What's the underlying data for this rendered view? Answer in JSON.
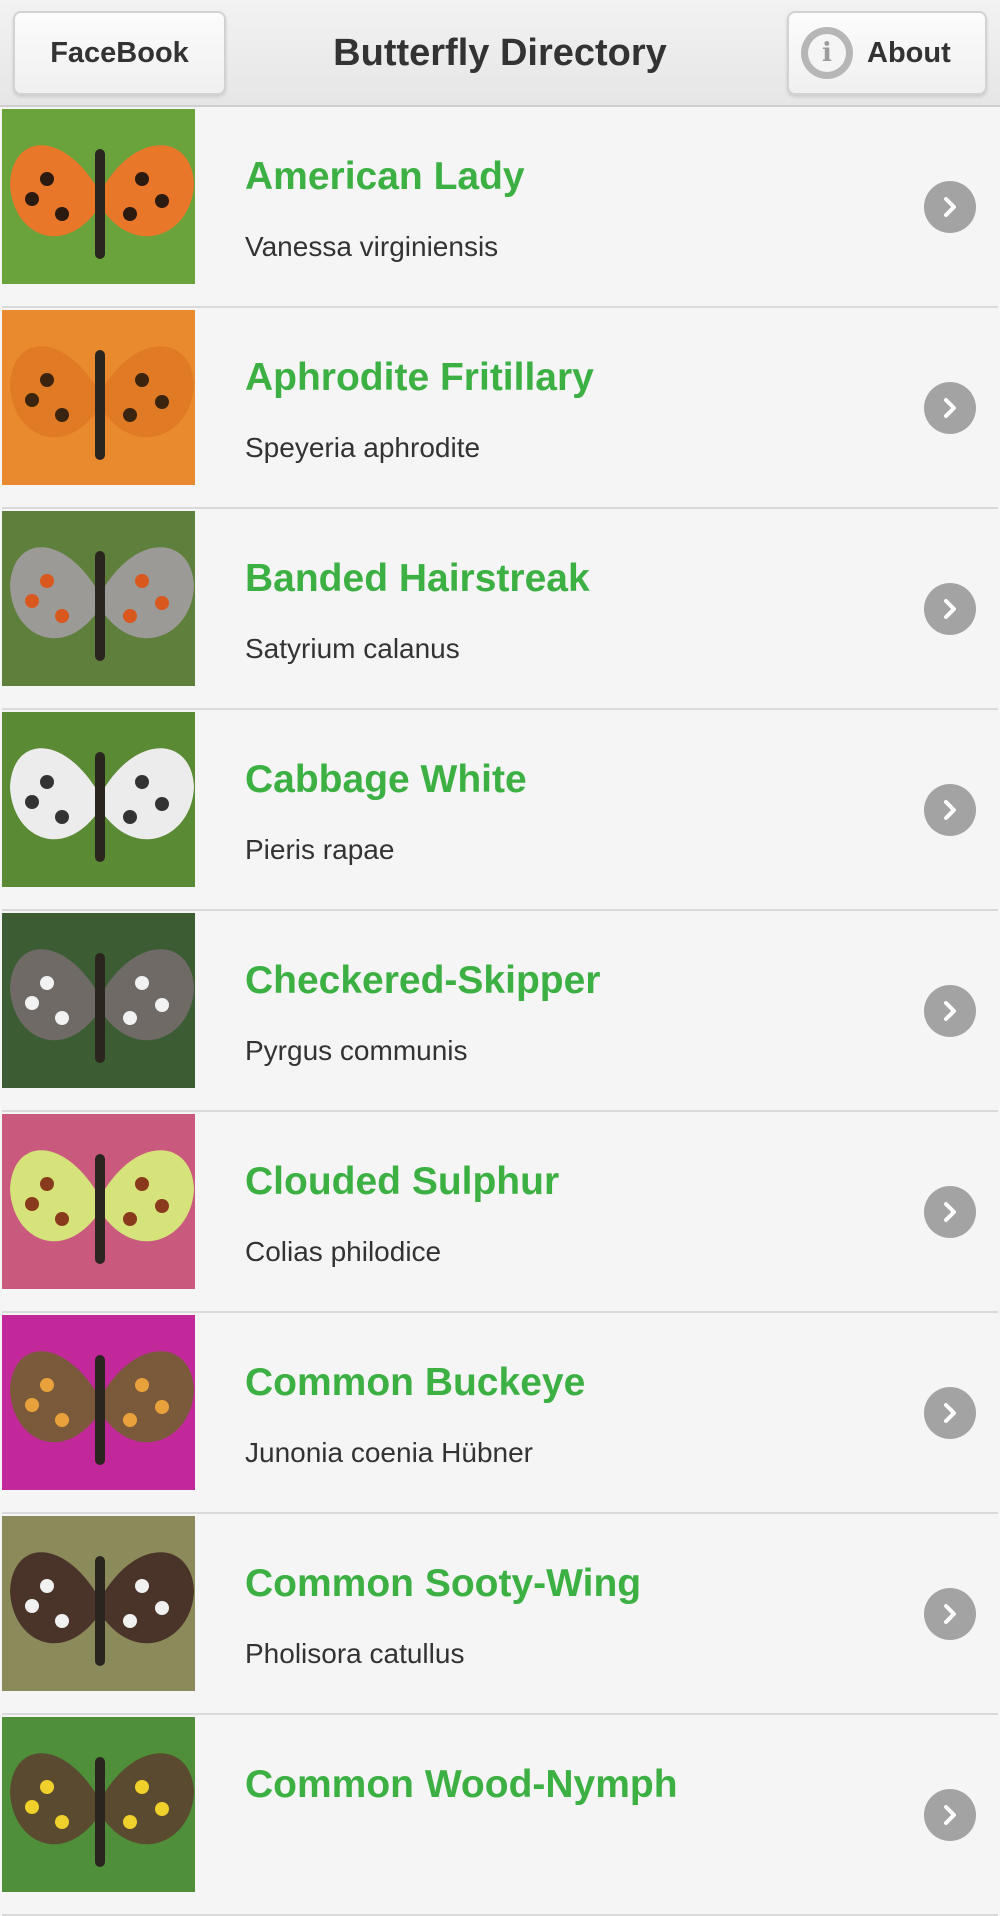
{
  "header": {
    "title": "Butterfly Directory",
    "facebook_label": "FaceBook",
    "about_label": "About",
    "about_icon": "info-icon"
  },
  "colors": {
    "accent_green": "#3cb043",
    "chevron_gray": "#a3a3a3"
  },
  "butterflies": [
    {
      "name": "American Lady",
      "scientific": "Vanessa virginiensis",
      "bg": "#6aa33c",
      "wing": "#e8772a",
      "spot": "#2a1a10"
    },
    {
      "name": "Aphrodite Fritillary",
      "scientific": "Speyeria aphrodite",
      "bg": "#e98a2e",
      "wing": "#e07a25",
      "spot": "#3a2410"
    },
    {
      "name": "Banded Hairstreak",
      "scientific": "Satyrium calanus",
      "bg": "#5f7f3c",
      "wing": "#9c9a96",
      "spot": "#d9581e"
    },
    {
      "name": "Cabbage White",
      "scientific": "Pieris rapae",
      "bg": "#5a8a34",
      "wing": "#ececec",
      "spot": "#333333"
    },
    {
      "name": "Checkered-Skipper",
      "scientific": "Pyrgus communis",
      "bg": "#3c5c34",
      "wing": "#6f6a66",
      "spot": "#f2f2f2"
    },
    {
      "name": "Clouded Sulphur",
      "scientific": "Colias philodice",
      "bg": "#c95a7e",
      "wing": "#d6e27a",
      "spot": "#8a3a1c"
    },
    {
      "name": "Common Buckeye",
      "scientific": "Junonia coenia Hübner",
      "bg": "#c2289a",
      "wing": "#7a5a3a",
      "spot": "#e9a13b"
    },
    {
      "name": "Common Sooty-Wing",
      "scientific": "Pholisora catullus",
      "bg": "#8a8a5a",
      "wing": "#4a3328",
      "spot": "#f1f1f1"
    },
    {
      "name": "Common Wood-Nymph",
      "scientific": "",
      "bg": "#4f8f3a",
      "wing": "#5a4a30",
      "spot": "#f0d02a"
    }
  ]
}
